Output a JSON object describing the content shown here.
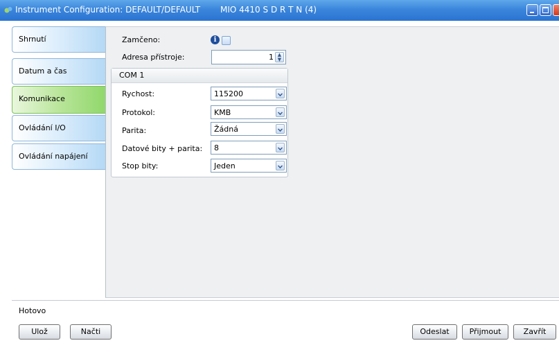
{
  "window": {
    "title": "Instrument Configuration: DEFAULT/DEFAULT",
    "title_extra": "MIO 4410 S D R T N (4)"
  },
  "sidebar": {
    "items": [
      {
        "label": "Shrnutí",
        "active": false
      },
      {
        "label": "Datum a čas",
        "active": false
      },
      {
        "label": "Komunikace",
        "active": true
      },
      {
        "label": "Ovládání I/O",
        "active": false
      },
      {
        "label": "Ovládání napájení",
        "active": false
      }
    ]
  },
  "main": {
    "locked_label": "Zamčeno:",
    "locked_checked": false,
    "info_icon": "i",
    "address_label": "Adresa přístroje:",
    "address_value": "1",
    "com_group": {
      "title": "COM 1",
      "fields": [
        {
          "label": "Rychost:",
          "value": "115200"
        },
        {
          "label": "Protokol:",
          "value": "KMB"
        },
        {
          "label": "Parita:",
          "value": "Žádná"
        },
        {
          "label": "Datové bity + parita:",
          "value": "8"
        },
        {
          "label": "Stop bity:",
          "value": "Jeden"
        }
      ]
    }
  },
  "status": {
    "text": "Hotovo"
  },
  "buttons": {
    "save": "Ulož",
    "load": "Načti",
    "send": "Odeslat",
    "receive": "Přijmout",
    "close": "Zavřít"
  },
  "colors": {
    "titlebar": "#3b86dc",
    "active_tab": "#8fd76a",
    "tab": "#b3d8f5",
    "content_bg": "#eef0f2"
  }
}
